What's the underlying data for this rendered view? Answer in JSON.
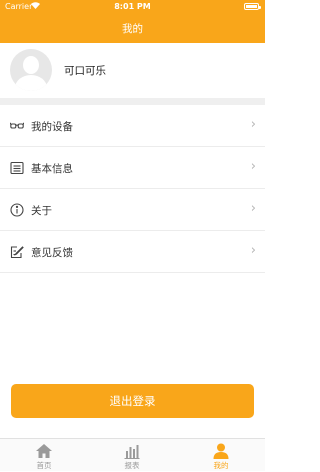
{
  "status_bar": {
    "carrier": "Carrier",
    "time": "8:01 PM"
  },
  "nav": {
    "title": "我的"
  },
  "profile": {
    "username": "可口可乐"
  },
  "menu": [
    {
      "label": "我的设备",
      "icon": "glasses-icon"
    },
    {
      "label": "基本信息",
      "icon": "document-icon"
    },
    {
      "label": "关于",
      "icon": "info-icon"
    },
    {
      "label": "意见反馈",
      "icon": "feedback-icon"
    }
  ],
  "logout": {
    "label": "退出登录"
  },
  "tabs": [
    {
      "label": "首页",
      "icon": "home-icon",
      "active": false
    },
    {
      "label": "报表",
      "icon": "bar-chart-icon",
      "active": false
    },
    {
      "label": "我的",
      "icon": "person-icon",
      "active": true
    }
  ],
  "colors": {
    "accent": "#f9a61a",
    "inactive": "#9a9a9a",
    "background": "#ffffff",
    "separator": "#efefef"
  }
}
